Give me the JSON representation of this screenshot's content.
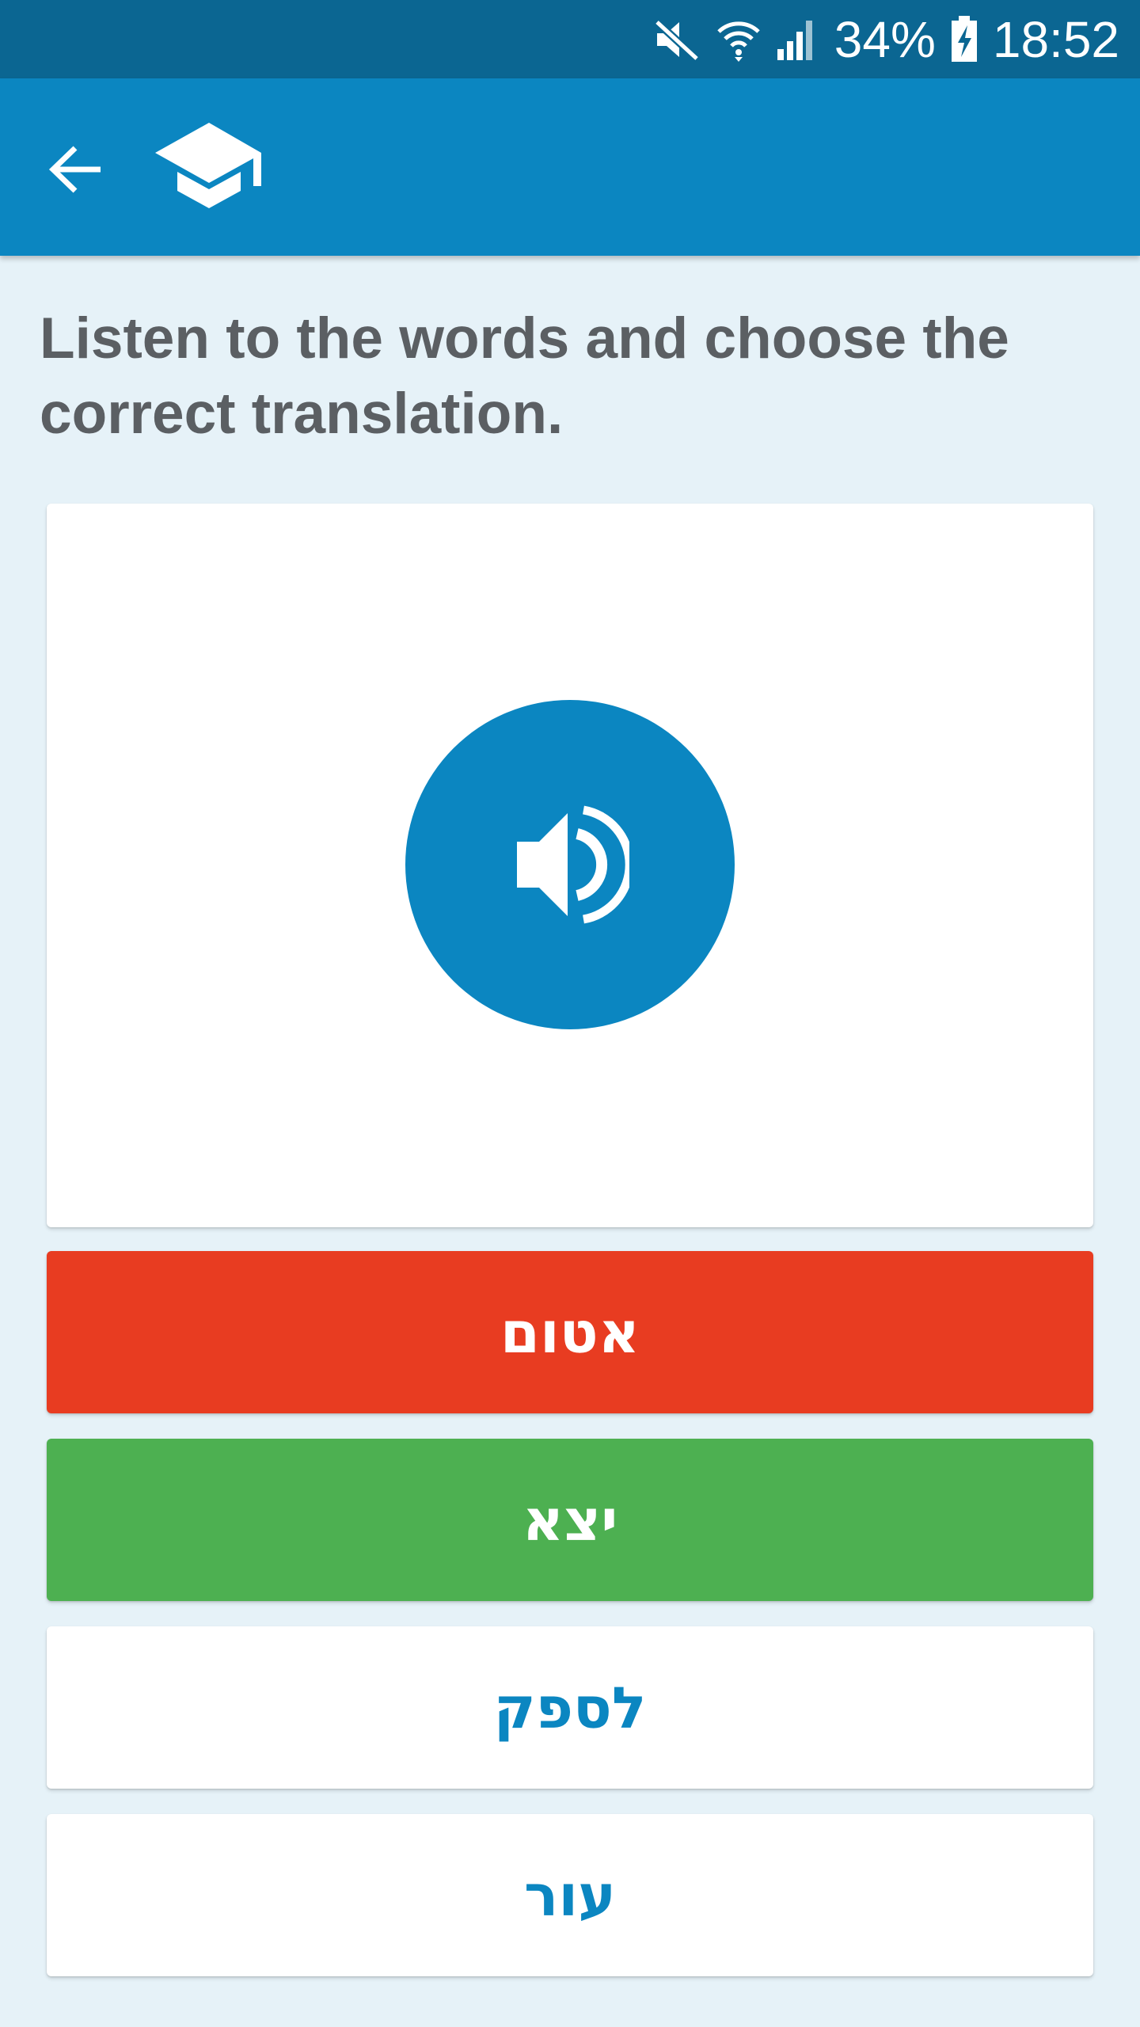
{
  "status_bar": {
    "battery": "34%",
    "time": "18:52",
    "icons": [
      "mute-icon",
      "wifi-icon",
      "cell-signal-icon",
      "battery-charging-icon"
    ]
  },
  "app_bar": {
    "back_icon": "arrow-left-icon",
    "logo_icon": "graduation-cap-icon",
    "color": "#0b86c1"
  },
  "instruction": "Listen to the words and choose the correct translation.",
  "audio": {
    "icon": "speaker-volume-icon",
    "color": "#0b86c1"
  },
  "answers": [
    {
      "label": "אטום",
      "state": "wrong",
      "color": "#e83c21"
    },
    {
      "label": "יצא",
      "state": "correct",
      "color": "#4db051"
    },
    {
      "label": "לספק",
      "state": "neutral",
      "color": "#ffffff"
    },
    {
      "label": "עור",
      "state": "neutral",
      "color": "#ffffff"
    }
  ]
}
